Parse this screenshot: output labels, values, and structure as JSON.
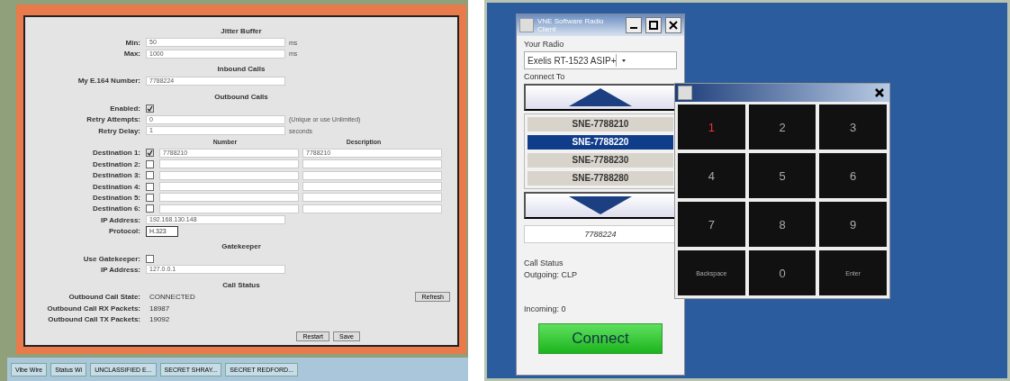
{
  "settings_window": {
    "rows": [
      {
        "kind": "heading",
        "text": "Jitter Buffer"
      },
      {
        "kind": "field",
        "label": "Min:",
        "value": "50",
        "unit": "ms"
      },
      {
        "kind": "field",
        "label": "Max:",
        "value": "1000",
        "unit": "ms"
      },
      {
        "kind": "heading",
        "text": "Inbound Calls"
      },
      {
        "kind": "field",
        "label": "My E.164 Number:",
        "value": "7788224"
      },
      {
        "kind": "heading",
        "text": "Outbound Calls"
      },
      {
        "kind": "check",
        "label": "Enabled:",
        "checked": true
      },
      {
        "kind": "field",
        "label": "Retry Attempts:",
        "value": "0",
        "unit": "(Unique or use Unlimited)"
      },
      {
        "kind": "field",
        "label": "Retry Delay:",
        "value": "1",
        "unit": "seconds"
      },
      {
        "kind": "colheads",
        "columns": [
          "Number",
          "Description"
        ]
      },
      {
        "kind": "dest",
        "label": "Destination 1:",
        "checked": true,
        "number": "7788210",
        "description": "7788210"
      },
      {
        "kind": "dest",
        "label": "Destination 2:",
        "checked": false
      },
      {
        "kind": "dest",
        "label": "Destination 3:",
        "checked": false
      },
      {
        "kind": "dest",
        "label": "Destination 4:",
        "checked": false
      },
      {
        "kind": "dest",
        "label": "Destination 5:",
        "checked": false
      },
      {
        "kind": "dest",
        "label": "Destination 6:",
        "checked": false
      },
      {
        "kind": "field",
        "label": "IP Address:",
        "value": "192.168.130.148"
      },
      {
        "kind": "select",
        "label": "Protocol:",
        "value": "H.323"
      },
      {
        "kind": "heading",
        "text": "Gatekeeper"
      },
      {
        "kind": "check",
        "label": "Use Gatekeeper:",
        "checked": false
      },
      {
        "kind": "field",
        "label": "IP Address:",
        "value": "127.0.0.1"
      },
      {
        "kind": "heading",
        "text": "Call Status"
      },
      {
        "kind": "status",
        "label": "Outbound Call State:",
        "value": "CONNECTED",
        "button": "Refresh"
      },
      {
        "kind": "status",
        "label": "Outbound Call RX Packets:",
        "value": "18987"
      },
      {
        "kind": "status",
        "label": "Outbound Call TX Packets:",
        "value": "19092"
      }
    ],
    "buttons": [
      "Restart",
      "Save"
    ]
  },
  "taskbar": {
    "items": [
      "Vibe Wire",
      "Status Wi",
      "UNCLASSIFIED E...",
      "SECRET SHRAY...",
      "SECRET REDFORD..."
    ]
  },
  "radio_window": {
    "title": "VNE Software Radio Client",
    "radio_label": "Your Radio",
    "radio": "Exelis RT-1523 ASIP+",
    "connect_label": "Connect To",
    "contacts": [
      {
        "name": "SNE-7788210",
        "selected": false
      },
      {
        "name": "SNE-7788220",
        "selected": true
      },
      {
        "name": "SNE-7788230",
        "selected": false
      },
      {
        "name": "SNE-7788280",
        "selected": false
      }
    ],
    "number": "7788224",
    "status_label": "Call Status",
    "outgoing": "Outgoing: CLP",
    "incoming": "Incoming: 0",
    "connect": "Connect"
  },
  "keypad": {
    "keys": [
      {
        "label": "1",
        "selected": true
      },
      {
        "label": "2",
        "selected": false
      },
      {
        "label": "3",
        "selected": false
      },
      {
        "label": "4",
        "selected": false
      },
      {
        "label": "5",
        "selected": false
      },
      {
        "label": "6",
        "selected": false
      },
      {
        "label": "7",
        "selected": false
      },
      {
        "label": "8",
        "selected": false
      },
      {
        "label": "9",
        "selected": false
      },
      {
        "label": "Backspace",
        "selected": false
      },
      {
        "label": "0",
        "selected": false
      },
      {
        "label": "Enter",
        "selected": false
      }
    ]
  }
}
